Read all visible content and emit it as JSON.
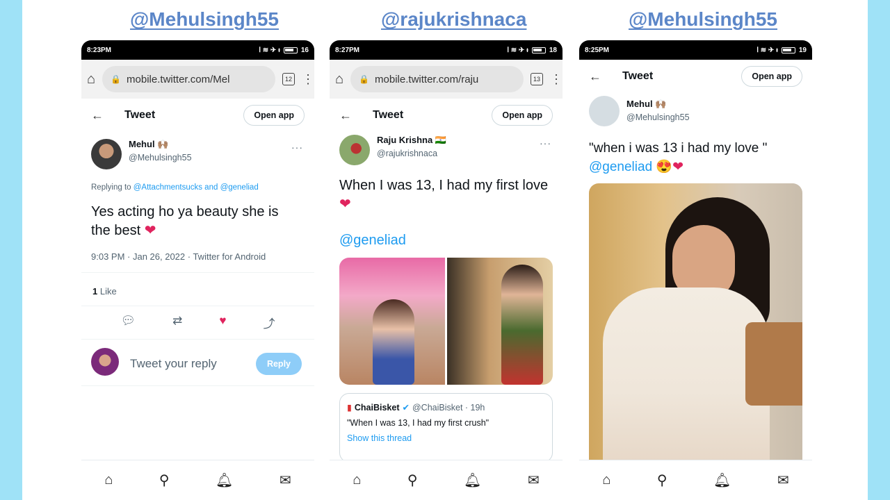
{
  "handles": [
    "@Mehulsingh55",
    "@rajukrishnaca",
    "@Mehulsingh55"
  ],
  "common": {
    "tweet_title": "Tweet",
    "open_app": "Open app",
    "status_icons": "ߊ ≋ ✈ ᵻ",
    "nav_icons": [
      "home-icon",
      "search-icon",
      "bell-icon",
      "mail-icon"
    ]
  },
  "phone1": {
    "time": "8:23PM",
    "battery": "16",
    "url": "mobile.twitter.com/Mel",
    "tabs": "12",
    "author_name": "Mehul 🙌🏽",
    "author_handle": "@Mehulsingh55",
    "replying_prefix": "Replying to",
    "replying_to": "@Attachmentsucks and @geneliad",
    "text_line1": "Yes acting ho ya beauty she is",
    "text_line2": "the best",
    "emoji": "❤",
    "meta": "9:03 PM · Jan 26, 2022 · Twitter for Android",
    "likes_count": "1",
    "likes_label": "Like",
    "reply_placeholder": "Tweet your reply",
    "reply_button": "Reply"
  },
  "phone2": {
    "time": "8:27PM",
    "battery": "18",
    "url": "mobile.twitter.com/raju",
    "tabs": "13",
    "author_name": "Raju Krishna 🇮🇳",
    "author_handle": "@rajukrishnaca",
    "text_line1": "When I was 13, I had my first love",
    "emoji": "❤",
    "mention": "@geneliad",
    "quote_name": "ChaiBisket",
    "quote_handle": "@ChaiBisket · 19h",
    "quote_text": "\"When I was 13, I had my first crush\"",
    "quote_link": "Show this thread"
  },
  "phone3": {
    "time": "8:25PM",
    "battery": "19",
    "author_name": "Mehul 🙌🏽",
    "author_handle": "@Mehulsingh55",
    "text_line1": "\"when i was 13 i had my love \"",
    "mention": "@geneliad",
    "emoji": "😍❤"
  }
}
